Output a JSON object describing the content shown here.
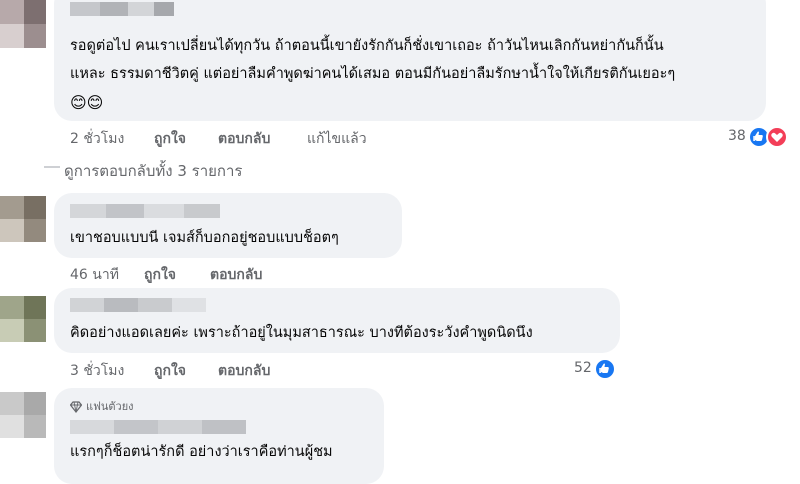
{
  "comment1": {
    "line1": "รอดูต่อไป คนเราเปลี่ยนได้ทุกวัน ถ้าตอนนี้เขายังรักกันก็ชั่งเขาเถอะ ถ้าวันไหนเลิกกันหย่ากันก็นั้น",
    "line2": "แหละ ธรรมดาชีวิตคู่ แต่อย่าลืมคำพูดฆ่าคนได้เสมอ ตอนมีกันอย่าลืมรักษาน้ำใจให้เกียรติกันเยอะๆ",
    "emoji": "😊😊",
    "time": "2 ชั่วโมง",
    "like": "ถูกใจ",
    "reply": "ตอบกลับ",
    "edited": "แก้ไขแล้ว",
    "reaction_count": "38"
  },
  "view_replies": "ดูการตอบกลับทั้ง 3 รายการ",
  "reply1": {
    "text": "เขาชอบแบบนี เจมส์ก็บอกอยู่ชอบแบบช็อตๆ",
    "time": "46 นาที",
    "like": "ถูกใจ",
    "reply": "ตอบกลับ"
  },
  "reply2": {
    "text": "คิดอย่างแอดเลยค่ะ เพราะถ้าอยู่ในมุมสาธารณะ บางทีต้องระวังคำพูดนิดนึง",
    "time": "3 ชั่วโมง",
    "like": "ถูกใจ",
    "reply": "ตอบกลับ",
    "reaction_count": "52"
  },
  "reply3": {
    "badge": "แฟนตัวยง",
    "text": "แรกๆก็ช็อตน่ารักดี อย่างว่าเราคือท่านผู้ชม"
  },
  "colors": {
    "like_blue": "#1877f2",
    "love_red": "#f33e58",
    "bubble": "#f0f2f5",
    "meta": "#65676b"
  }
}
